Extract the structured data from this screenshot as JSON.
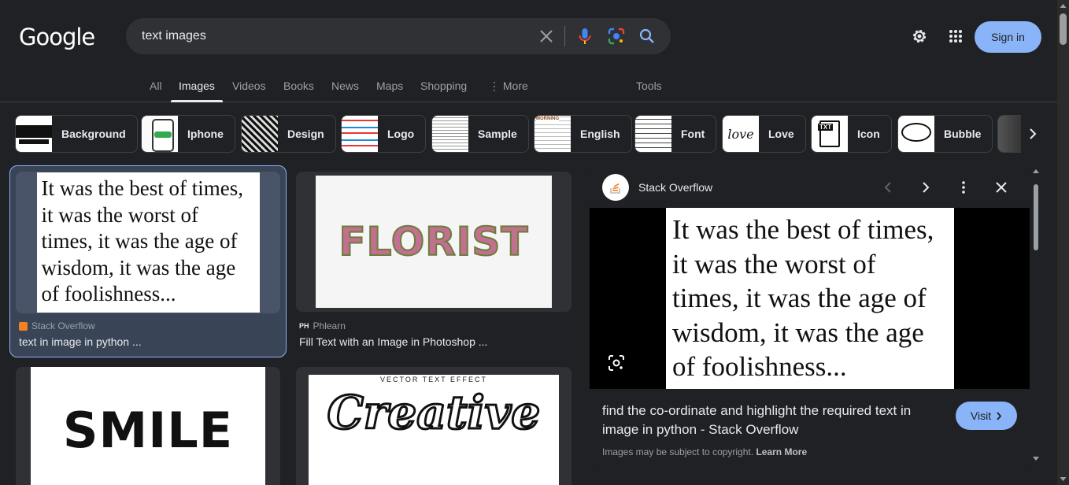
{
  "header": {
    "logo": "Google",
    "search_value": "text images",
    "sign_in": "Sign in"
  },
  "tabs": [
    {
      "label": "All"
    },
    {
      "label": "Images"
    },
    {
      "label": "Videos"
    },
    {
      "label": "Books"
    },
    {
      "label": "News"
    },
    {
      "label": "Maps"
    },
    {
      "label": "Shopping"
    },
    {
      "label": "More"
    },
    {
      "label": "Tools"
    }
  ],
  "chips": [
    {
      "label": "Background"
    },
    {
      "label": "Iphone"
    },
    {
      "label": "Design"
    },
    {
      "label": "Logo"
    },
    {
      "label": "Sample"
    },
    {
      "label": "English"
    },
    {
      "label": "Font"
    },
    {
      "label": "Love"
    },
    {
      "label": "Icon"
    },
    {
      "label": "Bubble"
    }
  ],
  "chip_thumbs": {
    "english": "MORNING",
    "love": "love",
    "icon": "TXT"
  },
  "results": [
    {
      "source": "Stack Overflow",
      "title": "text in image in python ...",
      "image_text": "It was the best of times, it was the worst of times, it was the age of wisdom, it was the age of foolishness..."
    },
    {
      "source": "Phlearn",
      "source_icon_text": "PH",
      "title": "Fill Text with an Image in Photoshop ...",
      "image_text": "FLORIST"
    },
    {
      "image_text": "SMILE"
    },
    {
      "image_text": "Creative",
      "image_subtext": "VECTOR TEXT EFFECT"
    }
  ],
  "panel": {
    "site": "Stack Overflow",
    "image_text": "It was the best of times, it was the worst of times, it was the age of wisdom, it was the age of foolishness...",
    "title": "find the co-ordinate and highlight the required text in image in python - Stack Overflow",
    "copyright": "Images may be subject to copyright.",
    "learn_more": "Learn More",
    "visit": "Visit"
  },
  "colors": {
    "background": "#202124",
    "accent": "#8ab4f8",
    "selected_card": "#394457",
    "panel_bg": "#171717"
  }
}
